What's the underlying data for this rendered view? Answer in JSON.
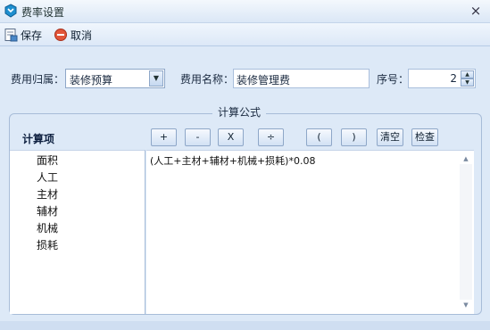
{
  "window": {
    "title": "费率设置",
    "close_label": "×"
  },
  "toolbar": {
    "save_label": "保存",
    "cancel_label": "取消"
  },
  "form": {
    "category_label": "费用归属：",
    "category_value": "装修预算",
    "name_label": "费用名称：",
    "name_value": "装修管理费",
    "seq_label": "序号：",
    "seq_value": "2"
  },
  "formula_group": {
    "title": "计算公式",
    "items_header": "计算项",
    "items": [
      "面积",
      "人工",
      "主材",
      "辅材",
      "机械",
      "损耗"
    ],
    "operators": [
      "+",
      "-",
      "X",
      "÷",
      "(",
      ")"
    ],
    "clear_label": "清空",
    "check_label": "检查",
    "formula": "(人工+主材+辅材+机械+损耗)*0.08"
  },
  "colors": {
    "background": "#dde9f7",
    "accent": "#2f6fb8"
  }
}
